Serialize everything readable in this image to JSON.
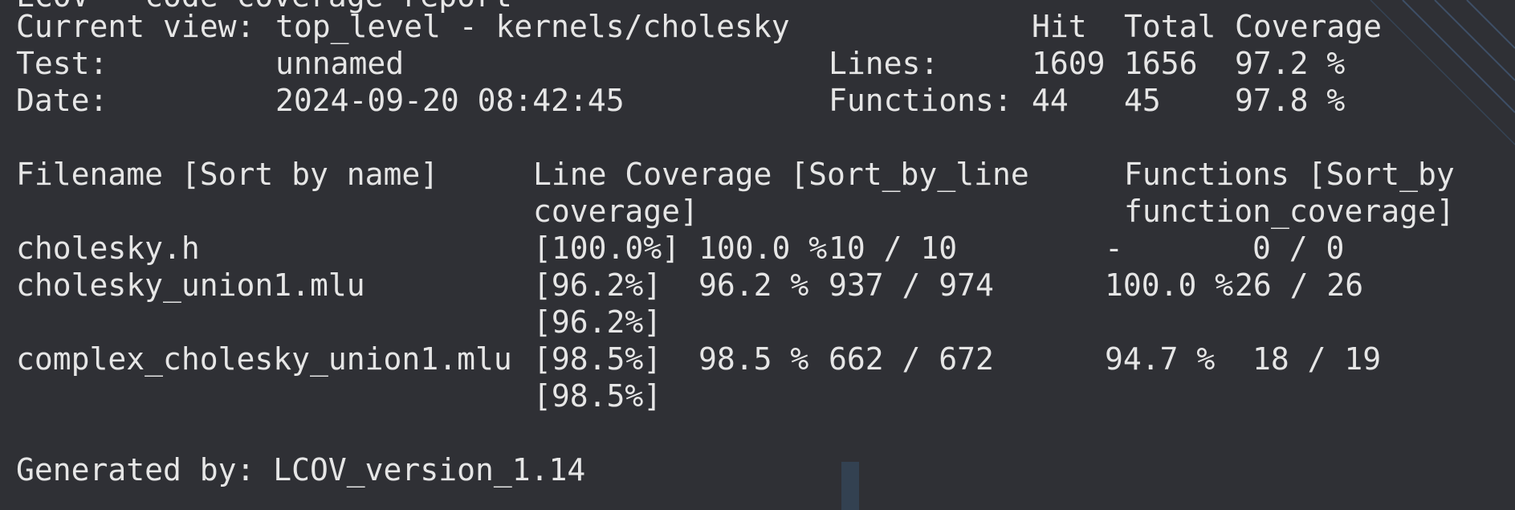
{
  "page_title_clipped": "LCOV - code coverage report",
  "header": {
    "current_view_label": "Current view:",
    "current_view_value": "top_level - kernels/cholesky",
    "test_label": "Test:",
    "test_value": "unnamed",
    "date_label": "Date:",
    "date_value": "2024-09-20 08:42:45",
    "col_hit": "Hit",
    "col_total": "Total",
    "col_coverage": "Coverage",
    "lines_label": "Lines:",
    "lines_hit": "1609",
    "lines_total": "1656",
    "lines_coverage": "97.2 %",
    "functions_label": "Functions:",
    "functions_hit": "44",
    "functions_total": "45",
    "functions_coverage": "97.8 %"
  },
  "table": {
    "filename_header": "Filename [Sort by name]",
    "line_cov_header_1": "Line Coverage [Sort_by_line",
    "line_cov_header_2": "coverage]",
    "func_header_1": "Functions [Sort_by",
    "func_header_2": "function_coverage]",
    "rows": [
      {
        "filename": "cholesky.h",
        "bar_text": "[100.0%]",
        "line_pct": "100.0 %",
        "line_counts": "10 / 10",
        "func_pct": "-",
        "func_counts": "0 / 0",
        "bar_text_2": ""
      },
      {
        "filename": "cholesky_union1.mlu",
        "bar_text": "[96.2%]",
        "line_pct": "96.2 %",
        "line_counts": "937 / 974",
        "func_pct": "100.0 %",
        "func_counts": "26 / 26",
        "bar_text_2": "[96.2%]"
      },
      {
        "filename": "complex_cholesky_union1.mlu",
        "bar_text": "[98.5%]",
        "line_pct": "98.5 %",
        "line_counts": "662 / 672",
        "func_pct": "94.7 %",
        "func_counts": "18 / 19",
        "bar_text_2": "[98.5%]"
      }
    ]
  },
  "footer": {
    "generated_by": "Generated by: LCOV_version_1.14"
  },
  "colors": {
    "background": "#2f3035",
    "text": "#e6e6e6"
  }
}
